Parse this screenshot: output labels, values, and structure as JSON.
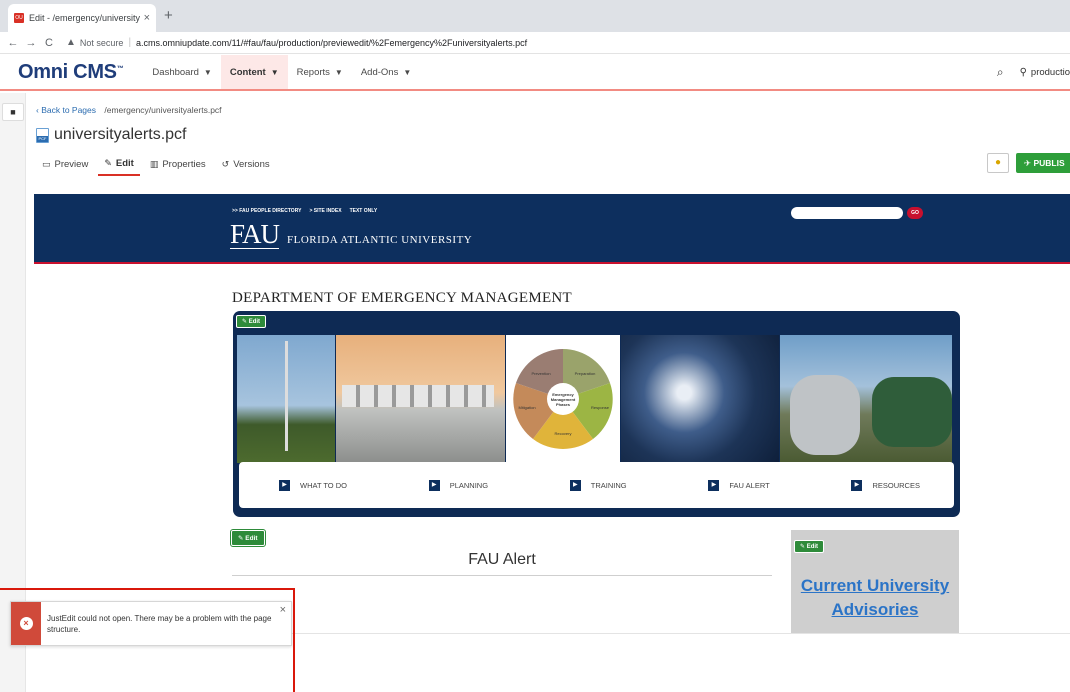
{
  "browser": {
    "tab_title": "Edit - /emergency/universityalert",
    "tab_favicon": "OU",
    "tab_close": "×",
    "new_tab": "+",
    "back": "←",
    "forward": "→",
    "reload": "C",
    "security_icon": "▲",
    "security_label": "Not secure",
    "url": "a.cms.omniupdate.com/11/#fau/fau/production/previewedit/%2Femergency%2Funiversityalerts.pcf"
  },
  "cms": {
    "logo": "Omni CMS",
    "menu": [
      {
        "label": "Dashboard",
        "active": false
      },
      {
        "label": "Content",
        "active": true
      },
      {
        "label": "Reports",
        "active": false
      },
      {
        "label": "Add-Ons",
        "active": false
      }
    ],
    "site_label": "productio",
    "search_icon": "⌕",
    "location_icon": "⚲"
  },
  "page": {
    "back_link": "Back to Pages",
    "path": "/emergency/universityalerts.pcf",
    "file_name": "universityalerts.pcf",
    "file_icon_label": "PCF",
    "tabs": [
      {
        "label": "Preview",
        "icon": "▭",
        "active": false
      },
      {
        "label": "Edit",
        "icon": "✎",
        "active": true
      },
      {
        "label": "Properties",
        "icon": "▥",
        "active": false
      },
      {
        "label": "Versions",
        "icon": "↺",
        "active": false
      }
    ],
    "publish_label": "PUBLIS",
    "tip_icon": "●"
  },
  "preview": {
    "top_links": [
      ">> FAU PEOPLE DIRECTORY",
      "> SITE INDEX",
      "TEXT ONLY"
    ],
    "logo_mark": "FAU",
    "university_name": "FLORIDA ATLANTIC UNIVERSITY",
    "go_label": "GO",
    "department_title": "DEPARTMENT OF EMERGENCY MANAGEMENT",
    "edit_label": "Edit",
    "wheel_segments": [
      "Prevention",
      "Preparation",
      "Response",
      "Recovery",
      "Mitigation"
    ],
    "wheel_center": "Emergency Management Phases",
    "quick_links": [
      "WHAT TO DO",
      "PLANNING",
      "TRAINING",
      "FAU ALERT",
      "RESOURCES"
    ],
    "alert_heading": "FAU Alert",
    "advisory_link_line1": "Current University",
    "advisory_link_line2": "Advisories"
  },
  "toast": {
    "message": "JustEdit could not open. There may be a problem with the page structure.",
    "close": "×",
    "icon": "×"
  },
  "colors": {
    "accent_red": "#d93025",
    "publish_green": "#2e9e3a",
    "fau_navy": "#0d2f5e",
    "link_blue": "#2b74c7",
    "error_red": "#d04a3a"
  }
}
